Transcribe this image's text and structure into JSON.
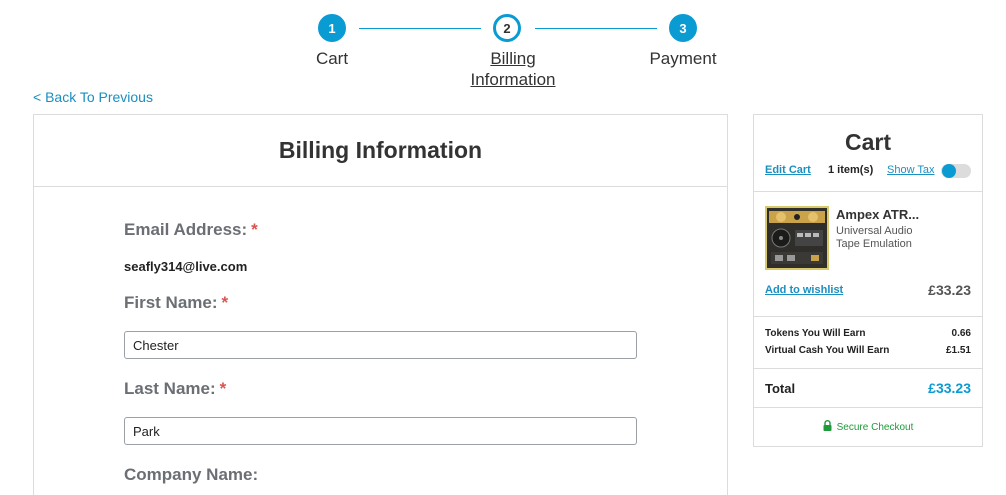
{
  "steps": [
    {
      "number": "1",
      "label": "Cart"
    },
    {
      "number": "2",
      "label_line1": "Billing",
      "label_line2": "Information"
    },
    {
      "number": "3",
      "label": "Payment"
    }
  ],
  "back_link": "< Back To Previous",
  "billing": {
    "title": "Billing Information",
    "email_label": "Email Address:",
    "email_value": "seafly314@live.com",
    "first_name_label": "First Name:",
    "first_name_value": "Chester",
    "last_name_label": "Last Name:",
    "last_name_value": "Park",
    "company_label": "Company Name:",
    "required_mark": "*"
  },
  "cart": {
    "title": "Cart",
    "edit_cart": "Edit Cart",
    "item_count": "1 item(s)",
    "show_tax": "Show Tax",
    "product": {
      "name": "Ampex ATR...",
      "brand": "Universal Audio",
      "category": "Tape Emulation",
      "price": "£33.23"
    },
    "add_to_wishlist": "Add to wishlist",
    "tokens_label": "Tokens You Will Earn",
    "tokens_value": "0.66",
    "virtual_cash_label": "Virtual Cash You Will Earn",
    "virtual_cash_value": "£1.51",
    "total_label": "Total",
    "total_value": "£33.23",
    "secure_checkout": "Secure Checkout"
  },
  "colors": {
    "accent": "#0b9bd3",
    "link": "#1a8fc0",
    "required": "#d9534f",
    "secure": "#1f9a3a"
  }
}
